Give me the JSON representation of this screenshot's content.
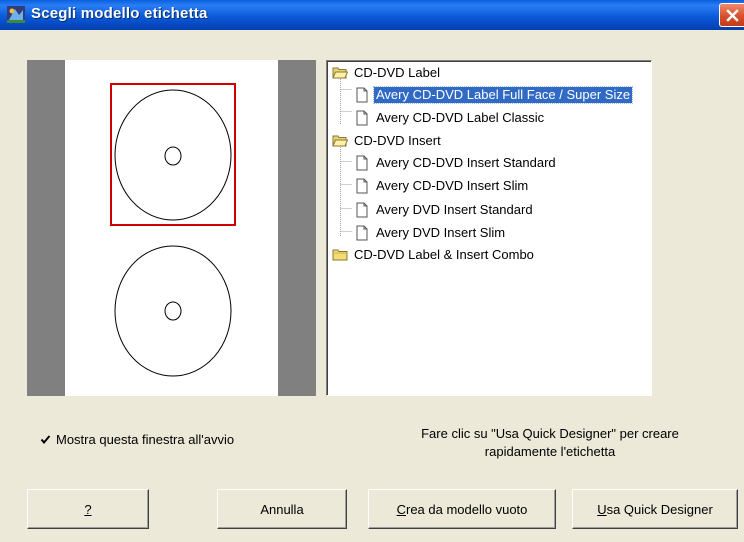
{
  "window": {
    "title": "Scegli modello etichetta",
    "title_icon": "app-icon",
    "close_icon": "close-icon"
  },
  "tree": {
    "groups": [
      {
        "label": "CD-DVD Label",
        "icon": "folder-open-icon",
        "items": [
          {
            "label": "Avery CD-DVD Label Full Face / Super Size",
            "selected": true,
            "icon": "document-icon"
          },
          {
            "label": "Avery CD-DVD Label Classic",
            "icon": "document-icon"
          }
        ]
      },
      {
        "label": "CD-DVD Insert",
        "icon": "folder-open-icon",
        "items": [
          {
            "label": "Avery CD-DVD Insert Standard",
            "icon": "document-icon"
          },
          {
            "label": "Avery CD-DVD Insert Slim",
            "icon": "document-icon"
          },
          {
            "label": "Avery DVD Insert Standard",
            "icon": "document-icon"
          },
          {
            "label": "Avery DVD Insert Slim",
            "icon": "document-icon"
          }
        ]
      },
      {
        "label": "CD-DVD Label & Insert Combo",
        "icon": "folder-closed-icon",
        "items": []
      }
    ]
  },
  "options": {
    "show_on_startup_label": "Mostra questa finestra all'avvio",
    "show_on_startup_checked": true
  },
  "hint": {
    "line1": "Fare clic su \"Usa Quick Designer\" per creare",
    "line2": "rapidamente l'etichetta"
  },
  "buttons": {
    "help": {
      "mnemonic": "?",
      "rest": ""
    },
    "cancel": {
      "label": "Annulla"
    },
    "blank": {
      "mnemonic": "C",
      "rest": "rea da modello vuoto"
    },
    "quick": {
      "mnemonic": "U",
      "rest": "sa Quick Designer"
    }
  },
  "colors": {
    "title_bar": "#0a5fe0",
    "selection": "#316ac5",
    "label_outline": "#d00000",
    "dialog_bg": "#ece9d8"
  }
}
